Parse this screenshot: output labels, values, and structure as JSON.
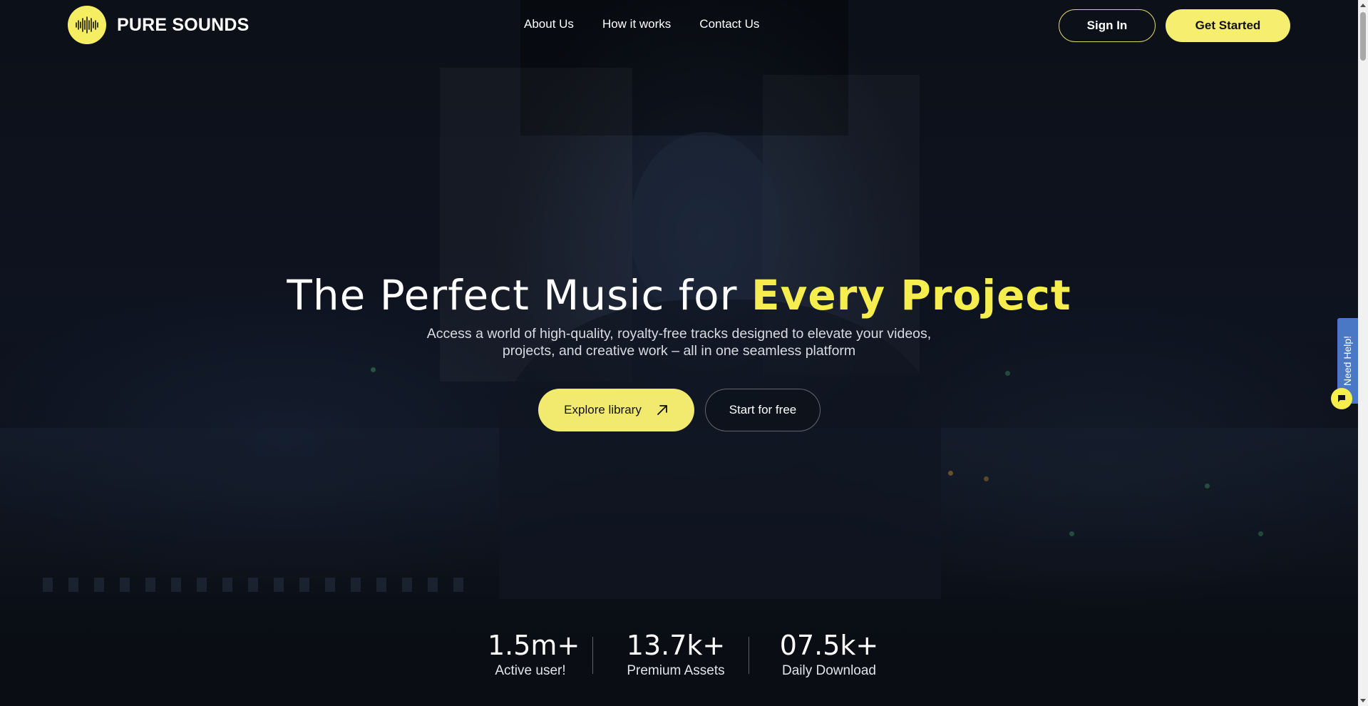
{
  "brand": {
    "name": "PURE SOUNDS",
    "accent": "#f5ee4e",
    "icon": "soundwave-icon"
  },
  "nav": {
    "items": [
      {
        "label": "About Us"
      },
      {
        "label": "How it works"
      },
      {
        "label": "Contact Us"
      }
    ]
  },
  "header": {
    "sign_in_label": "Sign In",
    "get_started_label": "Get Started"
  },
  "hero": {
    "title_prefix": "The Perfect Music for ",
    "title_highlight": "Every Project",
    "subtitle": "Access a world of high-quality, royalty-free tracks designed to elevate your videos, projects, and creative work – all in one seamless platform",
    "explore_label": "Explore library",
    "explore_icon": "arrow-up-right-icon",
    "start_free_label": "Start for free"
  },
  "stats": [
    {
      "value": "1.5m+",
      "label": "Active user!"
    },
    {
      "value": "13.7k+",
      "label": "Premium Assets"
    },
    {
      "value": "07.5k+",
      "label": "Daily Download"
    }
  ],
  "help": {
    "label": "Need Help!",
    "icon": "chat-icon"
  }
}
